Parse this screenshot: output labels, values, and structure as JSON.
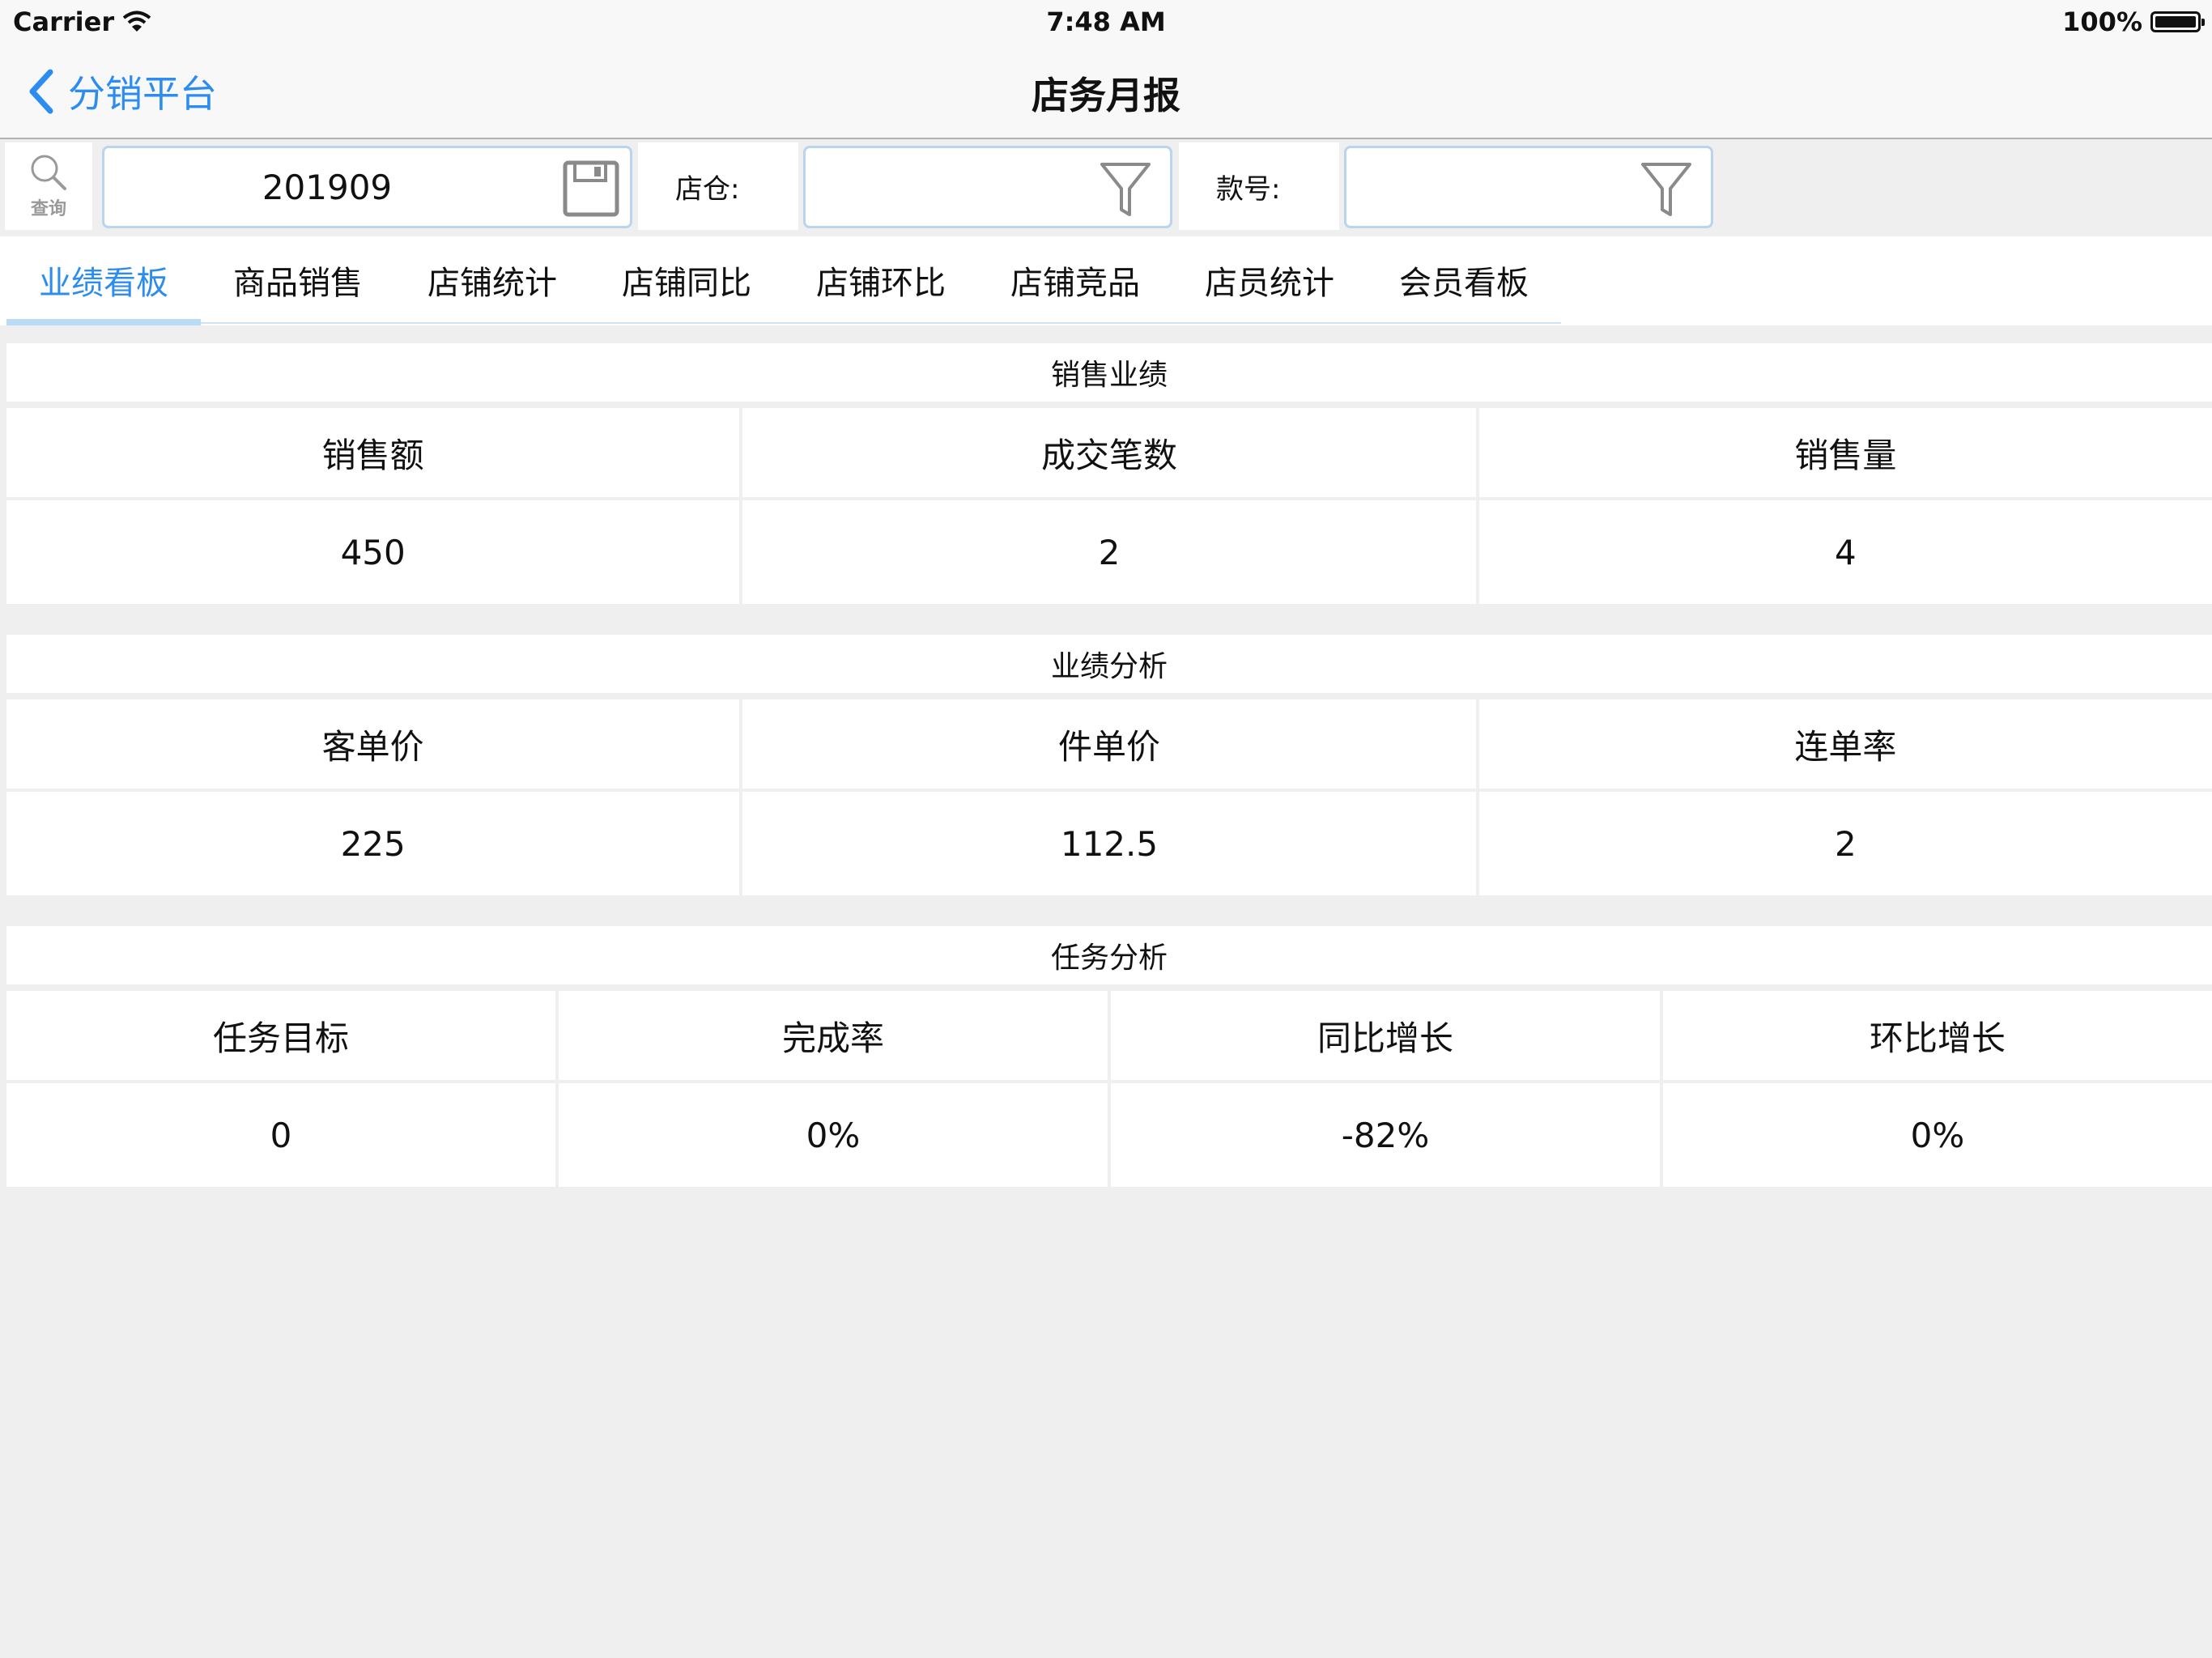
{
  "status_bar": {
    "carrier": "Carrier",
    "time": "7:48 AM",
    "battery": "100%"
  },
  "nav": {
    "back_label": "分销平台",
    "title": "店务月报"
  },
  "toolbar": {
    "query_label": "查询",
    "date_value": "201909",
    "store_label": "店仓:",
    "store_value": "",
    "style_label": "款号:",
    "style_value": ""
  },
  "tabs": [
    {
      "label": "业绩看板",
      "active": true
    },
    {
      "label": "商品销售"
    },
    {
      "label": "店铺统计"
    },
    {
      "label": "店铺同比"
    },
    {
      "label": "店铺环比"
    },
    {
      "label": "店铺竞品"
    },
    {
      "label": "店员统计"
    },
    {
      "label": "会员看板"
    }
  ],
  "sections": {
    "sales": {
      "title": "销售业绩",
      "headers": [
        "销售额",
        "成交笔数",
        "销售量"
      ],
      "values": [
        "450",
        "2",
        "4"
      ]
    },
    "analysis": {
      "title": "业绩分析",
      "headers": [
        "客单价",
        "件单价",
        "连单率"
      ],
      "values": [
        "225",
        "112.5",
        "2"
      ]
    },
    "task": {
      "title": "任务分析",
      "headers": [
        "任务目标",
        "完成率",
        "同比增长",
        "环比增长"
      ],
      "values": [
        "0",
        "0%",
        "-82%",
        "0%"
      ]
    }
  },
  "colors": {
    "accent": "#2d8cf0",
    "background": "#efefef",
    "input_border": "#b9d4ee"
  }
}
